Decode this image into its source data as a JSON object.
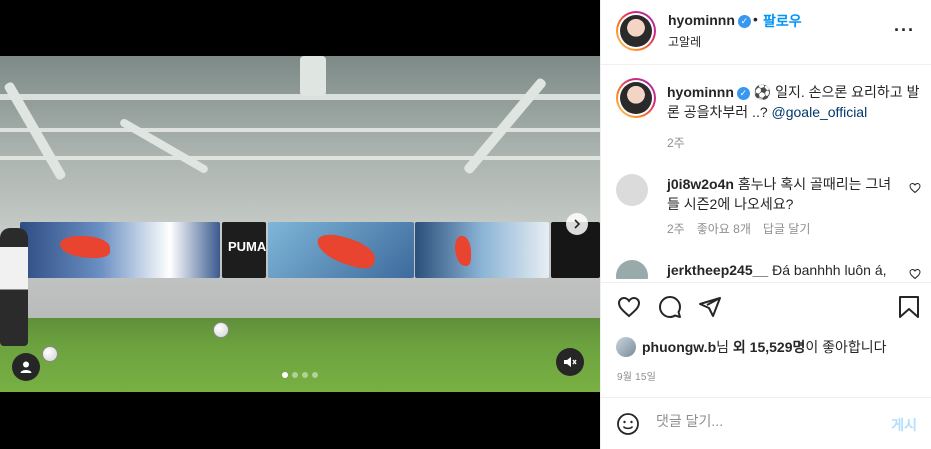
{
  "post": {
    "username": "hyominnn",
    "follow_label": "팔로우",
    "location": "고알레",
    "dot": "•",
    "caption_text": "⚽️ 일지. 손으론 요리하고 발론 공을차부러 ..? ",
    "caption_mention": "@goale_official",
    "caption_time": "2주",
    "more_icon": "more-icon"
  },
  "comments": [
    {
      "username": "j0i8w2o4n",
      "text": "홈누나 혹시 골때리는 그녀들 시즌2에 나오세요?",
      "time": "2주",
      "likes": "좋아요 8개",
      "reply": "답글 달기"
    },
    {
      "username": "jerktheep245__",
      "text": "Đá banhhh luôn á,"
    }
  ],
  "likes": {
    "user": "phuongw.b",
    "connector": "님 ",
    "others": "외 15,529명",
    "suffix": "이 좋아합니다"
  },
  "date": "9월 15일",
  "add_comment": {
    "placeholder": "댓글 달기...",
    "post_label": "게시"
  },
  "media": {
    "carousel_dots": 4,
    "active_dot": 0,
    "banner_brand": "PUMA"
  },
  "colors": {
    "accent": "#0095f6",
    "verified": "#3897f0",
    "muted": "#8e8e8e",
    "post_disabled": "#b2dffc"
  }
}
